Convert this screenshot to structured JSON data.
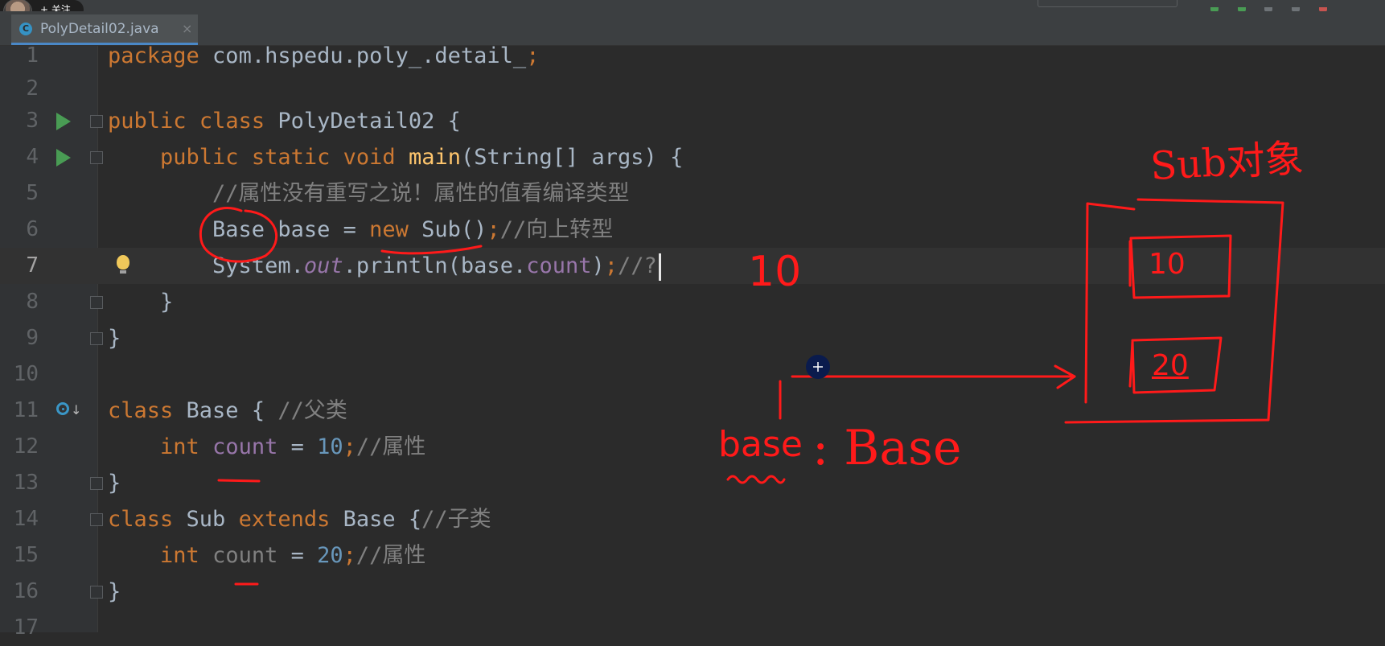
{
  "follow_button": {
    "label": "+ 关注"
  },
  "tab": {
    "filename": "PolyDetail02.java",
    "icon_letter": "C",
    "close_glyph": "×"
  },
  "editor": {
    "line_numbers": [
      "1",
      "2",
      "3",
      "4",
      "5",
      "6",
      "7",
      "8",
      "9",
      "10",
      "11",
      "12",
      "13",
      "14",
      "15",
      "16"
    ],
    "partial_next_line_number": "17",
    "caret_line": "7",
    "lines": {
      "l1": [
        "package",
        " com.hspedu.poly_.detail_",
        ";"
      ],
      "l3": [
        "public",
        " ",
        "class",
        " PolyDetail02 {"
      ],
      "l4": [
        "    ",
        "public",
        " ",
        "static",
        " ",
        "void",
        " ",
        "main",
        "(String[] args) {"
      ],
      "l5": [
        "        //属性没有重写之说！属性的值看编译类型"
      ],
      "l6": [
        "        Base base = ",
        "new",
        " Sub()",
        ";",
        "//向上转型"
      ],
      "l7": [
        "        System.",
        "out",
        ".println(base.",
        "count",
        ")",
        ";",
        "//?"
      ],
      "l8": [
        "    }"
      ],
      "l9": [
        "}"
      ],
      "l11": [
        "class",
        " Base { ",
        "//父类"
      ],
      "l12": [
        "    ",
        "int",
        " ",
        "count",
        " = ",
        "10",
        ";",
        "//属性"
      ],
      "l13": [
        "}"
      ],
      "l14": [
        "class",
        " Sub ",
        "extends",
        " Base {",
        "//子类"
      ],
      "l15": [
        "    ",
        "int",
        " ",
        "count",
        " = ",
        "20",
        ";",
        "//属性"
      ],
      "l16": [
        "}"
      ]
    }
  },
  "annotations": {
    "object_label": "Sub对象",
    "answer": "10",
    "field_value_1": "10",
    "field_value_2": "20",
    "reference_label": "base",
    "type_label": ": Base"
  },
  "colors": {
    "keyword": "#cc7832",
    "method": "#ffc66d",
    "field": "#9876aa",
    "number": "#6897bb",
    "comment": "#808080",
    "text": "#a9b7c6",
    "ink": "#ff1a1a"
  }
}
